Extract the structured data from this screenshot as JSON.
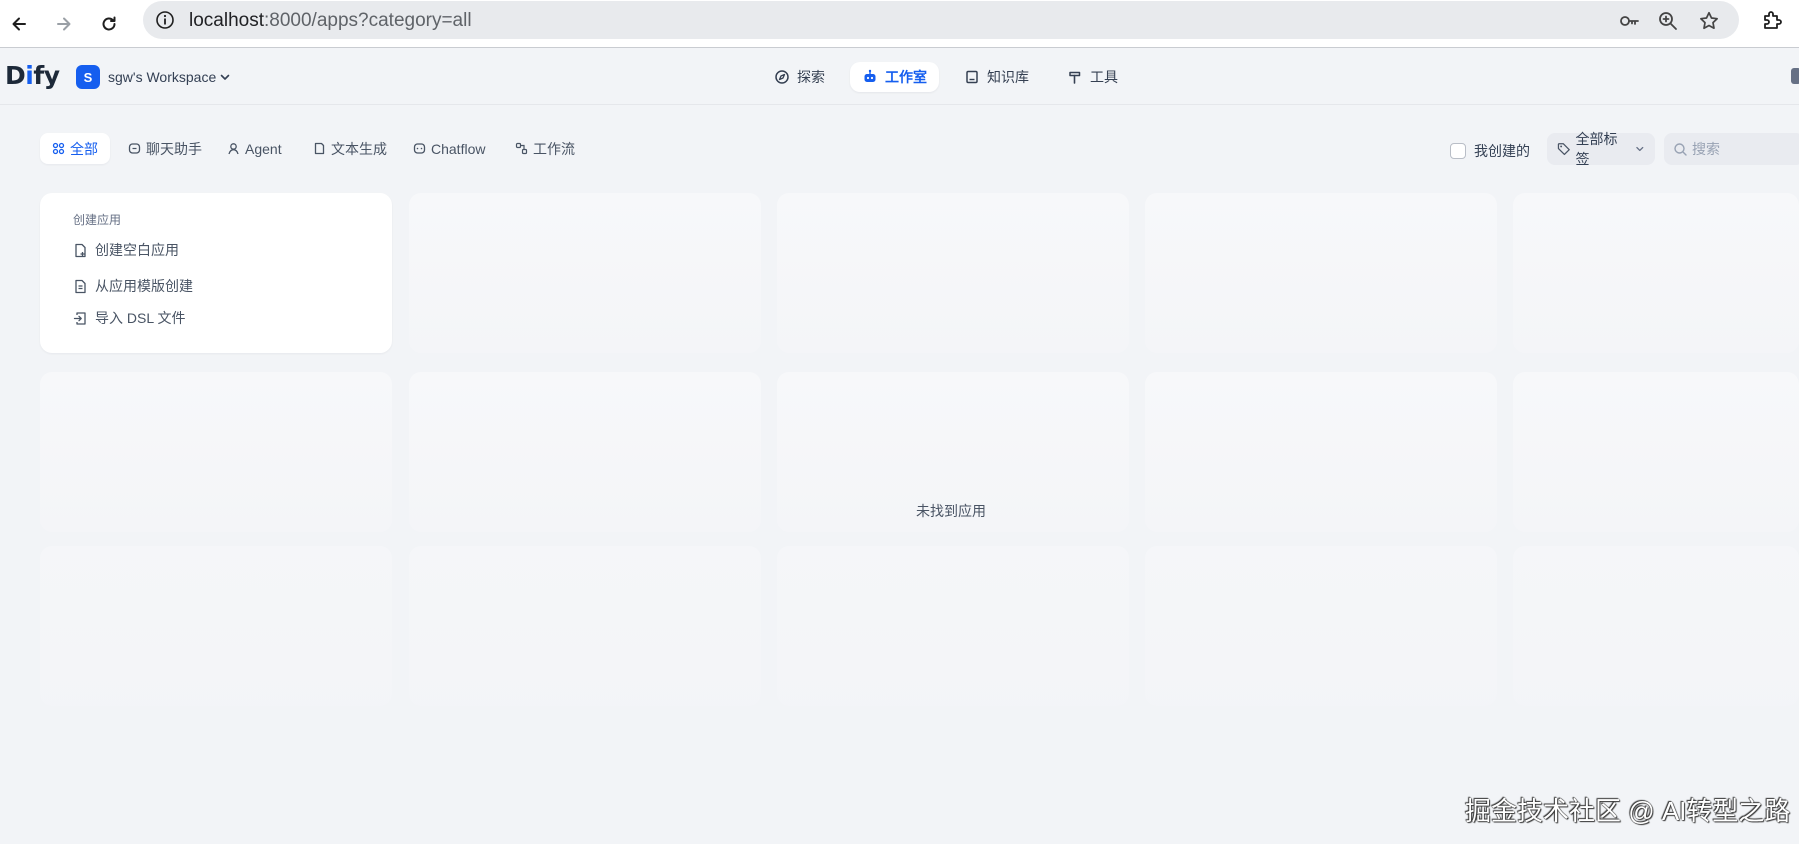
{
  "browser": {
    "url_host": "localhost",
    "url_rest": ":8000/apps?category=all",
    "icons": [
      "back-icon",
      "forward-icon",
      "reload-icon",
      "site-info-icon",
      "key-icon",
      "zoom-icon",
      "star-icon",
      "extensions-icon"
    ]
  },
  "header": {
    "logo_d": "D",
    "logo_i": "i",
    "logo_fy": "fy",
    "workspace_initial": "S",
    "workspace_name": "sgw's Workspace",
    "tabs": [
      {
        "label": "探索",
        "icon": "compass-icon"
      },
      {
        "label": "工作室",
        "icon": "robot-icon"
      },
      {
        "label": "知识库",
        "icon": "book-icon"
      },
      {
        "label": "工具",
        "icon": "hammer-icon"
      }
    ],
    "active_tab": "工作室",
    "accent": "#155eef"
  },
  "filters": {
    "categories": [
      {
        "label": "全部",
        "icon": "grid-icon"
      },
      {
        "label": "聊天助手",
        "icon": "chat-icon"
      },
      {
        "label": "Agent",
        "icon": "agent-icon"
      },
      {
        "label": "文本生成",
        "icon": "document-icon"
      },
      {
        "label": "Chatflow",
        "icon": "chatflow-icon"
      },
      {
        "label": "工作流",
        "icon": "workflow-icon"
      }
    ],
    "active_category": "全部",
    "created_by_me_label": "我创建的",
    "created_by_me_checked": false,
    "tags_label": "全部标签",
    "search_placeholder": "搜索",
    "search_value": ""
  },
  "create_card": {
    "title": "创建应用",
    "items": [
      {
        "label": "创建空白应用",
        "icon": "file-plus-icon"
      },
      {
        "label": "从应用模版创建",
        "icon": "template-icon"
      },
      {
        "label": "导入 DSL 文件",
        "icon": "import-icon"
      }
    ]
  },
  "empty_message": "未找到应用",
  "watermark": "掘金技术社区 @ AI转型之路"
}
